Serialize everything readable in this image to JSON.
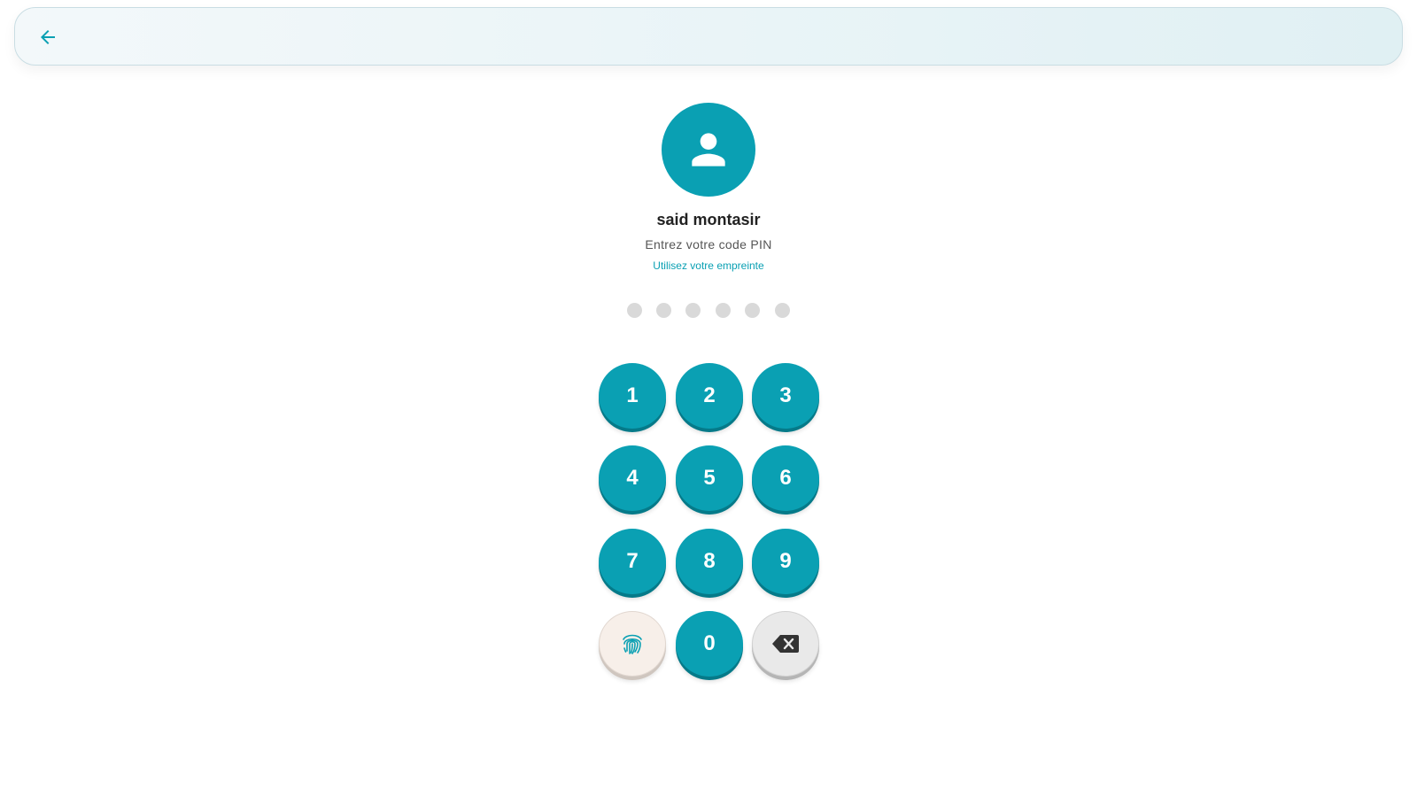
{
  "colors": {
    "accent": "#0aa0b3",
    "accent_shadow": "#057a89",
    "dot_empty": "#d9d9d9",
    "fingerprint_key_bg": "#f7efe9",
    "delete_key_bg": "#e9e9e9",
    "delete_icon": "#333333"
  },
  "header": {
    "back_icon": "arrow-left-icon"
  },
  "profile": {
    "avatar_icon": "person-icon",
    "name": "said montasir",
    "prompt": "Entrez votre code PIN",
    "fingerprint_link": "Utilisez votre empreinte"
  },
  "pin": {
    "length": 6,
    "entered": 0
  },
  "keypad": {
    "keys": [
      "1",
      "2",
      "3",
      "4",
      "5",
      "6",
      "7",
      "8",
      "9",
      "0"
    ],
    "fingerprint_icon": "fingerprint-icon",
    "delete_icon": "backspace-icon"
  }
}
